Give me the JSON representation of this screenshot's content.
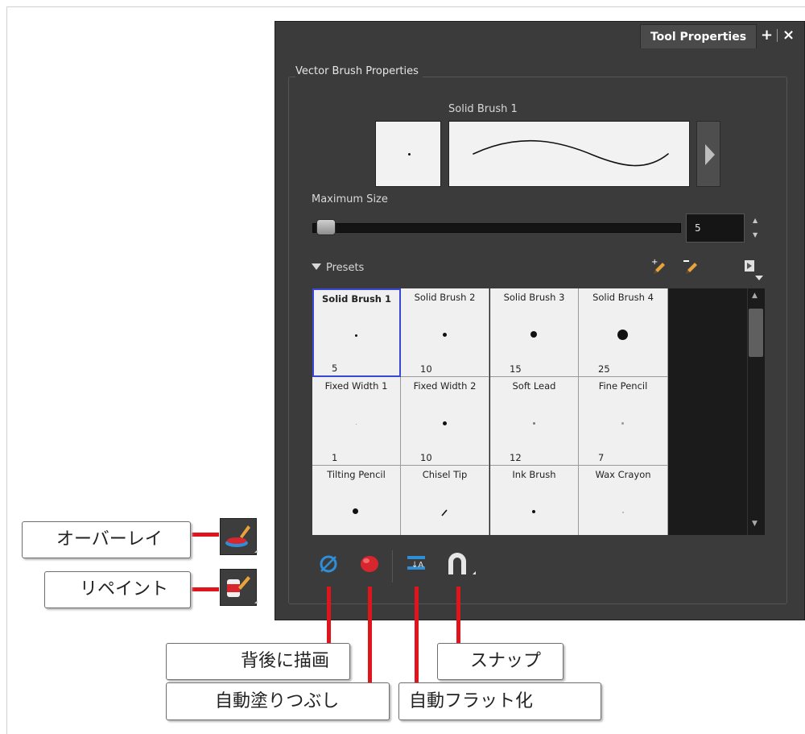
{
  "window": {
    "tab_title": "Tool Properties",
    "add_label": "+",
    "close_label": "×"
  },
  "panel": {
    "group_title": "Vector Brush Properties",
    "brush_name": "Solid Brush 1",
    "max_size_label": "Maximum Size",
    "max_size_value": "5",
    "presets_label": "Presets"
  },
  "presets": [
    {
      "name": "Solid Brush 1",
      "size": "5"
    },
    {
      "name": "Solid Brush 2",
      "size": "10"
    },
    {
      "name": "Solid Brush 3",
      "size": "15"
    },
    {
      "name": "Solid Brush 4",
      "size": "25"
    },
    {
      "name": "Fixed Width 1",
      "size": "1"
    },
    {
      "name": "Fixed Width 2",
      "size": "10"
    },
    {
      "name": "Soft Lead",
      "size": "12"
    },
    {
      "name": "Fine Pencil",
      "size": "7"
    },
    {
      "name": "Tilting Pencil",
      "size": ""
    },
    {
      "name": "Chisel Tip",
      "size": ""
    },
    {
      "name": "Ink Brush",
      "size": ""
    },
    {
      "name": "Wax Crayon",
      "size": ""
    }
  ],
  "callouts": {
    "overlay": "オーバーレイ",
    "repaint": "リペイント",
    "draw_behind": "背後に描画",
    "auto_fill": "自動塗りつぶし",
    "snap": "スナップ",
    "auto_flatten": "自動フラット化"
  },
  "colors": {
    "panel_bg": "#3b3b3b",
    "selection": "#3a46d6",
    "callout_line": "#e0151b"
  }
}
